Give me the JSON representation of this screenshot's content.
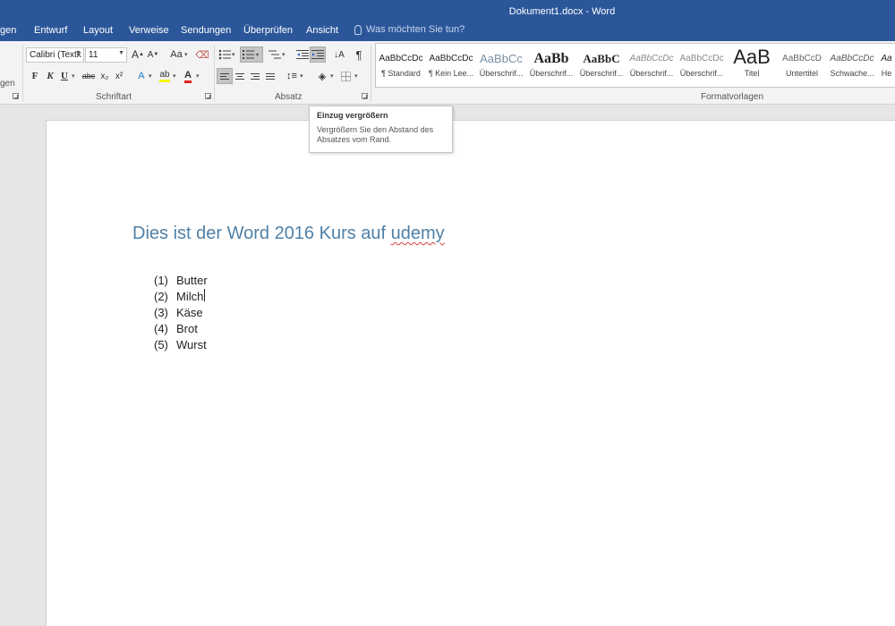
{
  "window": {
    "title": "Dokument1.docx - Word"
  },
  "tabs": [
    {
      "label": "gen"
    },
    {
      "label": "Entwurf"
    },
    {
      "label": "Layout"
    },
    {
      "label": "Verweise"
    },
    {
      "label": "Sendungen"
    },
    {
      "label": "Überprüfen"
    },
    {
      "label": "Ansicht"
    }
  ],
  "tell_me": {
    "placeholder": "Was möchten Sie tun?"
  },
  "ribbon": {
    "left_partial_label": "gen",
    "font": {
      "name": "Calibri (Textk",
      "size": "11",
      "grow_label": "A",
      "shrink_label": "A",
      "case_label": "Aa",
      "bold": "F",
      "italic": "K",
      "underline": "U",
      "strike": "abc",
      "subscript": "x₂",
      "superscript": "x²",
      "effects": "A",
      "highlight": "ab",
      "font_color": "A",
      "group_label": "Schriftart",
      "font_color_hex": "#e02020",
      "highlight_hex": "#f5f500"
    },
    "paragraph": {
      "group_label": "Absatz"
    },
    "styles": {
      "group_label": "Formatvorlagen",
      "items": [
        {
          "sample": "AaBbCcDc",
          "name": "¶ Standard"
        },
        {
          "sample": "AaBbCcDc",
          "name": "¶ Kein Lee..."
        },
        {
          "sample": "AaBbCc",
          "name": "Überschrif..."
        },
        {
          "sample": "AaBb",
          "name": "Überschrif..."
        },
        {
          "sample": "AaBbC",
          "name": "Überschrif..."
        },
        {
          "sample": "AaBbCcDc",
          "name": "Überschrif..."
        },
        {
          "sample": "AaBbCcDc",
          "name": "Überschrif..."
        },
        {
          "sample": "AaB",
          "name": "Titel"
        },
        {
          "sample": "AaBbCcD",
          "name": "Untertitel"
        },
        {
          "sample": "AaBbCcDc",
          "name": "Schwache..."
        },
        {
          "sample": "Aa",
          "name": "He"
        }
      ]
    }
  },
  "tooltip": {
    "title": "Einzug vergrößern",
    "body": "Vergrößern Sie den Abstand des Absatzes vom Rand."
  },
  "document": {
    "heading_main": "Dies ist der Word 2016 Kurs auf ",
    "heading_misspelled": "udemy",
    "list": [
      {
        "num": "(1)",
        "text": "Butter"
      },
      {
        "num": "(2)",
        "text": "Milch"
      },
      {
        "num": "(3)",
        "text": "Käse"
      },
      {
        "num": "(4)",
        "text": "Brot"
      },
      {
        "num": "(5)",
        "text": "Wurst"
      }
    ]
  }
}
